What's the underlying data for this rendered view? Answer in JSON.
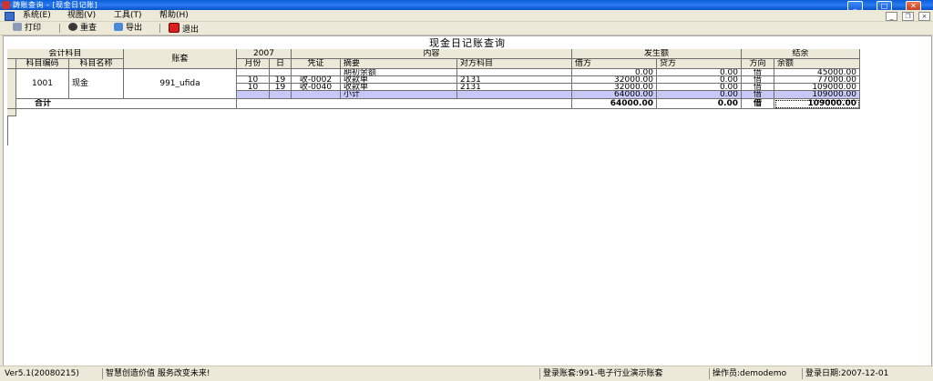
{
  "window": {
    "title": "踌账查询 - [现金日记账]",
    "buttons": {
      "minimize": "_",
      "maximize": "□",
      "close": "✕"
    }
  },
  "menubar": {
    "items": [
      "系统(E)",
      "视图(V)",
      "工具(T)",
      "帮助(H)"
    ],
    "mdi_buttons": {
      "minimize": "_",
      "restore": "❐",
      "close": "×"
    }
  },
  "toolbar": {
    "print": "打印",
    "filter": "重查",
    "export": "导出",
    "exit": "退出"
  },
  "report": {
    "title": "现金日记账查询",
    "headers": {
      "account_group": "会计科目",
      "account_code": "科目编码",
      "account_name": "科目名称",
      "ledger": "账套",
      "year": "2007",
      "month": "月份",
      "day": "日",
      "content": "内容",
      "voucher": "凭证",
      "summary": "摘要",
      "counter_account": "对方科目",
      "amount_group": "发生额",
      "debit": "借方",
      "credit": "贷方",
      "balance_group": "结余",
      "direction": "方向",
      "balance": "余额"
    },
    "account": {
      "code": "1001",
      "name": "现金",
      "ledger": "991_ufida"
    },
    "rows": [
      {
        "month": "",
        "day": "",
        "voucher": "",
        "summary": "期初余额",
        "counter": "",
        "debit": "0.00",
        "credit": "0.00",
        "dir": "借",
        "balance": "45000.00"
      },
      {
        "month": "10",
        "day": "19",
        "voucher": "收-0002",
        "summary": "收款单",
        "counter": "2131",
        "debit": "32000.00",
        "credit": "0.00",
        "dir": "借",
        "balance": "77000.00"
      },
      {
        "month": "10",
        "day": "19",
        "voucher": "收-0040",
        "summary": "收款单",
        "counter": "2131",
        "debit": "32000.00",
        "credit": "0.00",
        "dir": "借",
        "balance": "109000.00"
      },
      {
        "month": "",
        "day": "",
        "voucher": "",
        "summary": "小计",
        "counter": "",
        "debit": "64000.00",
        "credit": "0.00",
        "dir": "借",
        "balance": "109000.00"
      }
    ],
    "total": {
      "label": "合计",
      "debit": "64000.00",
      "credit": "0.00",
      "dir": "借",
      "balance": "109000.00"
    }
  },
  "statusbar": {
    "version": "Ver5.1(20080215)",
    "slogan": "智慧创造价值 服务改变未来!",
    "login_ledger": "登录账套:991-电子行业演示账套",
    "operator": "操作员:demodemo",
    "login_date": "登录日期:2007-12-01"
  }
}
